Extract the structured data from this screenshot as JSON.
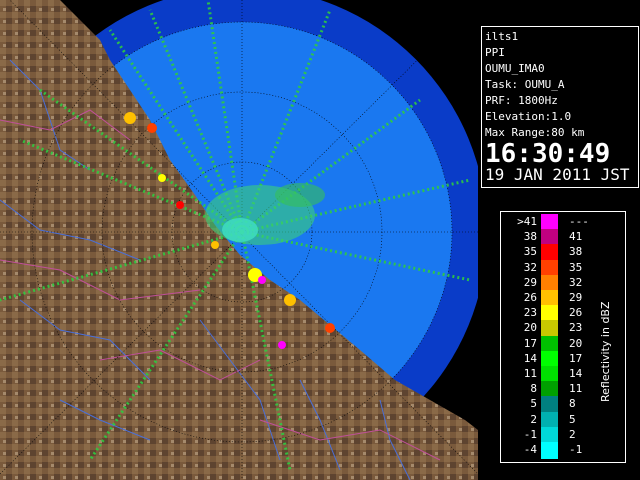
{
  "info": {
    "lines": [
      "ilts1",
      "PPI",
      "OUMU_IMA0",
      "Task: OUMU_A",
      "PRF: 1800Hz",
      "Elevation:1.0",
      "Max Range:80 km"
    ],
    "time": "16:30:49",
    "date": "19 JAN 2011 JST"
  },
  "legend": {
    "title": "Reflectivity in dBZ",
    "rows": [
      {
        "left": ">41",
        "right": "---",
        "color": "#ff00ff"
      },
      {
        "left": "38",
        "right": "41",
        "color": "#c00080"
      },
      {
        "left": "35",
        "right": "38",
        "color": "#ff0000"
      },
      {
        "left": "32",
        "right": "35",
        "color": "#ff4000"
      },
      {
        "left": "29",
        "right": "32",
        "color": "#ff8000"
      },
      {
        "left": "26",
        "right": "29",
        "color": "#ffc000"
      },
      {
        "left": "23",
        "right": "26",
        "color": "#ffff00"
      },
      {
        "left": "20",
        "right": "23",
        "color": "#c8c800"
      },
      {
        "left": "17",
        "right": "20",
        "color": "#00c000"
      },
      {
        "left": "14",
        "right": "17",
        "color": "#00ff00"
      },
      {
        "left": "11",
        "right": "14",
        "color": "#00e000"
      },
      {
        "left": "8",
        "right": "11",
        "color": "#00a000"
      },
      {
        "left": "5",
        "right": "8",
        "color": "#008080"
      },
      {
        "left": "2",
        "right": "5",
        "color": "#00b0b0"
      },
      {
        "left": "-1",
        "right": "2",
        "color": "#00d8d8"
      },
      {
        "left": "-4",
        "right": "-1",
        "color": "#00ffff"
      }
    ]
  },
  "map": {
    "land_color": "#7a5a3c",
    "sea_color": "#1a78f0",
    "outer_coverage_color": "#0a3cc8"
  }
}
